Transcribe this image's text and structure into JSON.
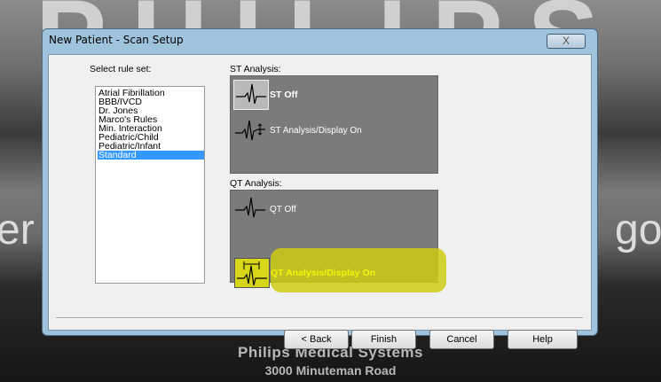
{
  "background": {
    "logo_text": "PHILIPS",
    "left_fragment": "er",
    "right_fragment": "gori",
    "company": "Philips Medical Systems",
    "address": "3000 Minuteman Road"
  },
  "dialog": {
    "title": "New Patient - Scan Setup",
    "close_label": "X"
  },
  "rule_set": {
    "label": "Select rule set:",
    "items": [
      "Atrial Fibrillation",
      "BBB/IVCD",
      "Dr. Jones",
      "Marco's Rules",
      "Min. Interaction",
      "Pediatric/Child",
      "Pediatric/Infant",
      "Standard"
    ],
    "selected": "Standard"
  },
  "st_analysis": {
    "label": "ST Analysis:",
    "options": [
      {
        "label": "ST Off",
        "selected": true
      },
      {
        "label": "ST Analysis/Display On",
        "selected": false
      }
    ]
  },
  "qt_analysis": {
    "label": "QT Analysis:",
    "options": [
      {
        "label": "QT Off",
        "selected": false
      },
      {
        "label": "QT Analysis/Display On",
        "selected": true
      }
    ]
  },
  "buttons": {
    "back": "< Back",
    "finish": "Finish",
    "cancel": "Cancel",
    "help": "Help"
  },
  "colors": {
    "selection_blue": "#3399ff",
    "panel_gray": "#7b7b7b",
    "highlight_yellow": "#d7d619"
  }
}
